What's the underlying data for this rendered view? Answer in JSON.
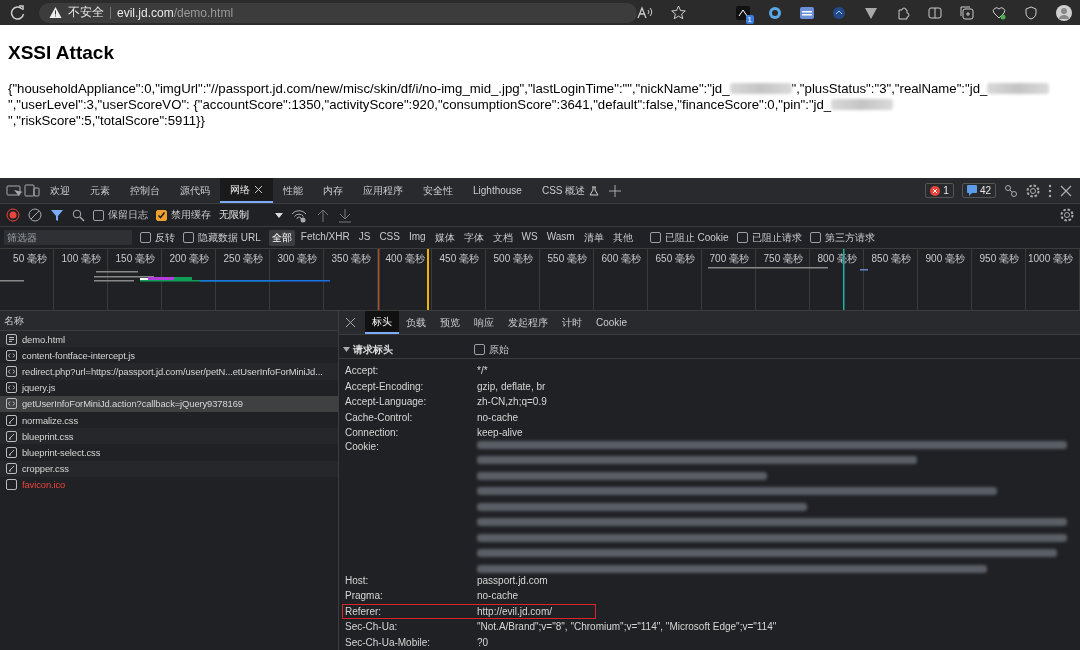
{
  "browser": {
    "warning": "不安全",
    "host": "evil.jd.com",
    "path": "/demo.html",
    "extension_badge": "1"
  },
  "page": {
    "title": "XSSI Attack",
    "body": [
      {
        "kind": "text",
        "text": "{\"householdAppliance\":0,\"imgUrl\":\"//passport.jd.com/new/misc/skin/df/i/no-img_mid_.jpg\",\"lastLoginTime\":\"\",\"nickName\":\"jd_"
      },
      {
        "kind": "redacted"
      },
      {
        "kind": "text",
        "text": "\",\"plusStatus\":\"3\",\"realName\":\"jd_"
      },
      {
        "kind": "redacted"
      },
      {
        "kind": "text",
        "text": "\",\"userLevel\":3,\"userScoreVO\": {\"accountScore\":1350,\"activityScore\":920,\"consumptionScore\":3641,\"default\":false,\"financeScore\":0,\"pin\":\"jd_"
      },
      {
        "kind": "redacted"
      },
      {
        "kind": "text",
        "text": "\",\"riskScore\":5,\"totalScore\":5911}}"
      }
    ]
  },
  "devtools": {
    "tabs": [
      {
        "label": "欢迎",
        "selected": false,
        "closable": false,
        "experimental": false
      },
      {
        "label": "元素",
        "selected": false,
        "closable": false,
        "experimental": false
      },
      {
        "label": "控制台",
        "selected": false,
        "closable": false,
        "experimental": false
      },
      {
        "label": "源代码",
        "selected": false,
        "closable": false,
        "experimental": false
      },
      {
        "label": "网络",
        "selected": true,
        "closable": true,
        "experimental": false
      },
      {
        "label": "性能",
        "selected": false,
        "closable": false,
        "experimental": false
      },
      {
        "label": "内存",
        "selected": false,
        "closable": false,
        "experimental": false
      },
      {
        "label": "应用程序",
        "selected": false,
        "closable": false,
        "experimental": false
      },
      {
        "label": "安全性",
        "selected": false,
        "closable": false,
        "experimental": false
      },
      {
        "label": "Lighthouse",
        "selected": false,
        "closable": false,
        "experimental": false
      },
      {
        "label": "CSS 概述",
        "selected": false,
        "closable": false,
        "experimental": true
      }
    ],
    "errors": "1",
    "messages": "42",
    "toolbar": {
      "recording": true,
      "filter_active": true,
      "checkboxes": [
        {
          "label": "保留日志",
          "checked": false
        },
        {
          "label": "禁用缓存",
          "checked": true
        }
      ],
      "throttle": "无限制"
    },
    "filter": {
      "placeholder": "筛选器",
      "checkboxes_before": [
        {
          "label": "反转",
          "checked": false
        },
        {
          "label": "隐藏数据 URL",
          "checked": false
        }
      ],
      "types": [
        {
          "label": "全部",
          "selected": true
        },
        {
          "label": "Fetch/XHR",
          "selected": false
        },
        {
          "label": "JS",
          "selected": false
        },
        {
          "label": "CSS",
          "selected": false
        },
        {
          "label": "Img",
          "selected": false
        },
        {
          "label": "媒体",
          "selected": false
        },
        {
          "label": "字体",
          "selected": false
        },
        {
          "label": "文档",
          "selected": false
        },
        {
          "label": "WS",
          "selected": false
        },
        {
          "label": "Wasm",
          "selected": false
        },
        {
          "label": "清单",
          "selected": false
        },
        {
          "label": "其他",
          "selected": false
        }
      ],
      "checkboxes_after": [
        {
          "label": "已阻止 Cookie",
          "checked": false
        },
        {
          "label": "已阻止请求",
          "checked": false
        },
        {
          "label": "第三方请求",
          "checked": false
        }
      ]
    },
    "timeline_ticks": [
      "50 毫秒",
      "100 毫秒",
      "150 毫秒",
      "200 毫秒",
      "250 毫秒",
      "300 毫秒",
      "350 毫秒",
      "400 毫秒",
      "450 毫秒",
      "500 毫秒",
      "550 毫秒",
      "600 毫秒",
      "650 毫秒",
      "700 毫秒",
      "750 毫秒",
      "800 毫秒",
      "850 毫秒",
      "900 毫秒",
      "950 毫秒",
      "1000 毫秒"
    ],
    "requests": {
      "column": "名称",
      "rows": [
        {
          "name": "demo.html",
          "kind": "document",
          "selected": false,
          "failed": false
        },
        {
          "name": "content-fontface-intercept.js",
          "kind": "script",
          "selected": false,
          "failed": false
        },
        {
          "name": "redirect.php?url=https://passport.jd.com/user/petN...etUserInfoForMiniJd...",
          "kind": "script",
          "selected": false,
          "failed": false
        },
        {
          "name": "jquery.js",
          "kind": "script",
          "selected": false,
          "failed": false
        },
        {
          "name": "getUserInfoForMiniJd.action?callback=jQuery9378169",
          "kind": "script",
          "selected": true,
          "failed": false
        },
        {
          "name": "normalize.css",
          "kind": "stylesheet",
          "selected": false,
          "failed": false
        },
        {
          "name": "blueprint.css",
          "kind": "stylesheet",
          "selected": false,
          "failed": false
        },
        {
          "name": "blueprint-select.css",
          "kind": "stylesheet",
          "selected": false,
          "failed": false
        },
        {
          "name": "cropper.css",
          "kind": "stylesheet",
          "selected": false,
          "failed": false
        },
        {
          "name": "favicon.ico",
          "kind": "other",
          "selected": false,
          "failed": true
        }
      ]
    },
    "details": {
      "tabs": [
        {
          "label": "标头",
          "selected": true
        },
        {
          "label": "负载",
          "selected": false
        },
        {
          "label": "预览",
          "selected": false
        },
        {
          "label": "响应",
          "selected": false
        },
        {
          "label": "发起程序",
          "selected": false
        },
        {
          "label": "计时",
          "selected": false
        },
        {
          "label": "Cookie",
          "selected": false
        }
      ],
      "section": {
        "title": "请求标头",
        "expanded": true,
        "raw_label": "原始",
        "raw_checked": false
      },
      "headers": [
        {
          "name": "Accept:",
          "value": "*/*",
          "kind": "text",
          "highlighted": false
        },
        {
          "name": "Accept-Encoding:",
          "value": "gzip, deflate, br",
          "kind": "text",
          "highlighted": false
        },
        {
          "name": "Accept-Language:",
          "value": "zh-CN,zh;q=0.9",
          "kind": "text",
          "highlighted": false
        },
        {
          "name": "Cache-Control:",
          "value": "no-cache",
          "kind": "text",
          "highlighted": false
        },
        {
          "name": "Connection:",
          "value": "keep-alive",
          "kind": "text",
          "highlighted": false
        },
        {
          "name": "Cookie:",
          "kind": "redacted",
          "highlighted": false
        },
        {
          "name": "Host:",
          "value": "passport.jd.com",
          "kind": "text",
          "highlighted": false
        },
        {
          "name": "Pragma:",
          "value": "no-cache",
          "kind": "text",
          "highlighted": false
        },
        {
          "name": "Referer:",
          "value": "http://evil.jd.com/",
          "kind": "text",
          "highlighted": true
        },
        {
          "name": "Sec-Ch-Ua:",
          "value": "\"Not.A/Brand\";v=\"8\", \"Chromium\";v=\"114\", \"Microsoft Edge\";v=\"114\"",
          "kind": "text",
          "highlighted": false
        },
        {
          "name": "Sec-Ch-Ua-Mobile:",
          "value": "?0",
          "kind": "text",
          "highlighted": false
        }
      ]
    }
  }
}
